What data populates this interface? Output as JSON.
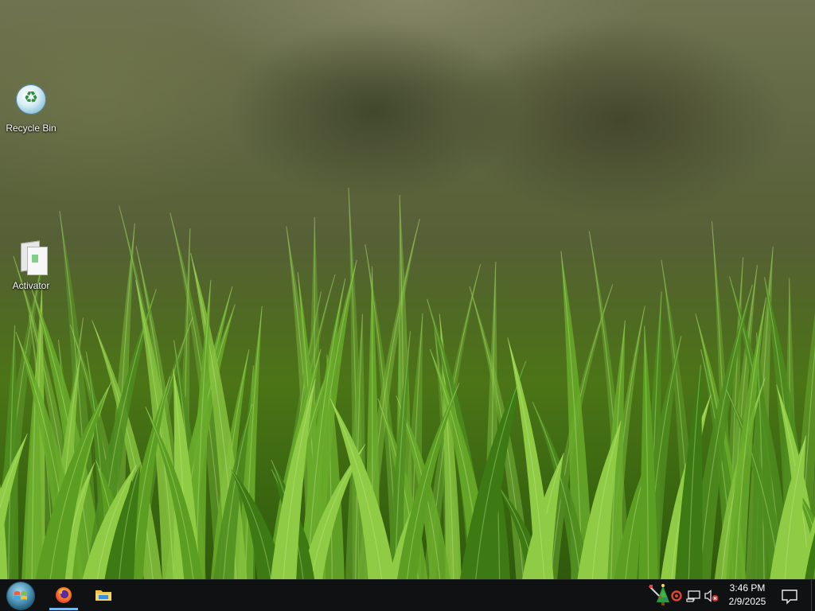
{
  "desktop": {
    "icons": [
      {
        "label": "Recycle Bin",
        "icon": "recycle-bin-icon"
      },
      {
        "label": "Activator",
        "icon": "document-icon"
      }
    ]
  },
  "taskbar": {
    "start": {
      "icon": "start-orb-icon"
    },
    "pinned": [
      {
        "icon": "firefox-icon",
        "active": true
      },
      {
        "icon": "file-explorer-icon",
        "active": false
      }
    ],
    "tray": {
      "icons": [
        "christmas-tree-icon",
        "record-icon",
        "network-icon",
        "speaker-muted-icon"
      ]
    },
    "clock": {
      "time": "3:46 PM",
      "date": "2/9/2025"
    },
    "action_center": {
      "icon": "notification-icon"
    }
  },
  "colors": {
    "taskbar_bg": "#0f1112",
    "active_underline": "#76b9ed",
    "grass": "#6aa82a"
  }
}
